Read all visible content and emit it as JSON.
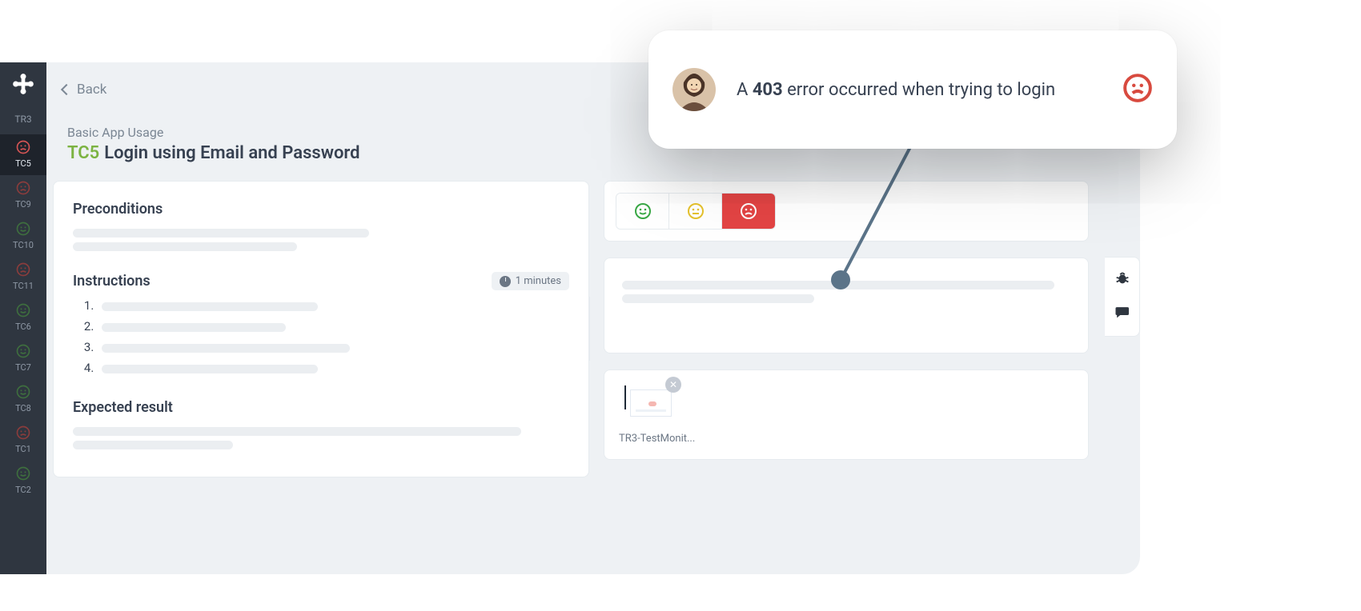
{
  "back_label": "Back",
  "breadcrumb": "Basic App Usage",
  "tc_code": "TC5",
  "tc_title": "Login using Email and Password",
  "sections": {
    "preconditions": "Preconditions",
    "instructions": "Instructions",
    "expected": "Expected result"
  },
  "time_estimate": "1 minutes",
  "attachment_name": "TR3-TestMonit...",
  "sidebar": {
    "run": "TR3",
    "items": [
      {
        "code": "TC5",
        "status": "fail",
        "active": true
      },
      {
        "code": "TC9",
        "status": "fail",
        "active": false
      },
      {
        "code": "TC10",
        "status": "pass",
        "active": false
      },
      {
        "code": "TC11",
        "status": "fail",
        "active": false
      },
      {
        "code": "TC6",
        "status": "pass",
        "active": false
      },
      {
        "code": "TC7",
        "status": "pass",
        "active": false
      },
      {
        "code": "TC8",
        "status": "pass",
        "active": false
      },
      {
        "code": "TC1",
        "status": "fail",
        "active": false
      },
      {
        "code": "TC2",
        "status": "pass",
        "active": false
      }
    ]
  },
  "toast": {
    "prefix": "A ",
    "bold": "403",
    "suffix": " error occurred when trying to login"
  }
}
